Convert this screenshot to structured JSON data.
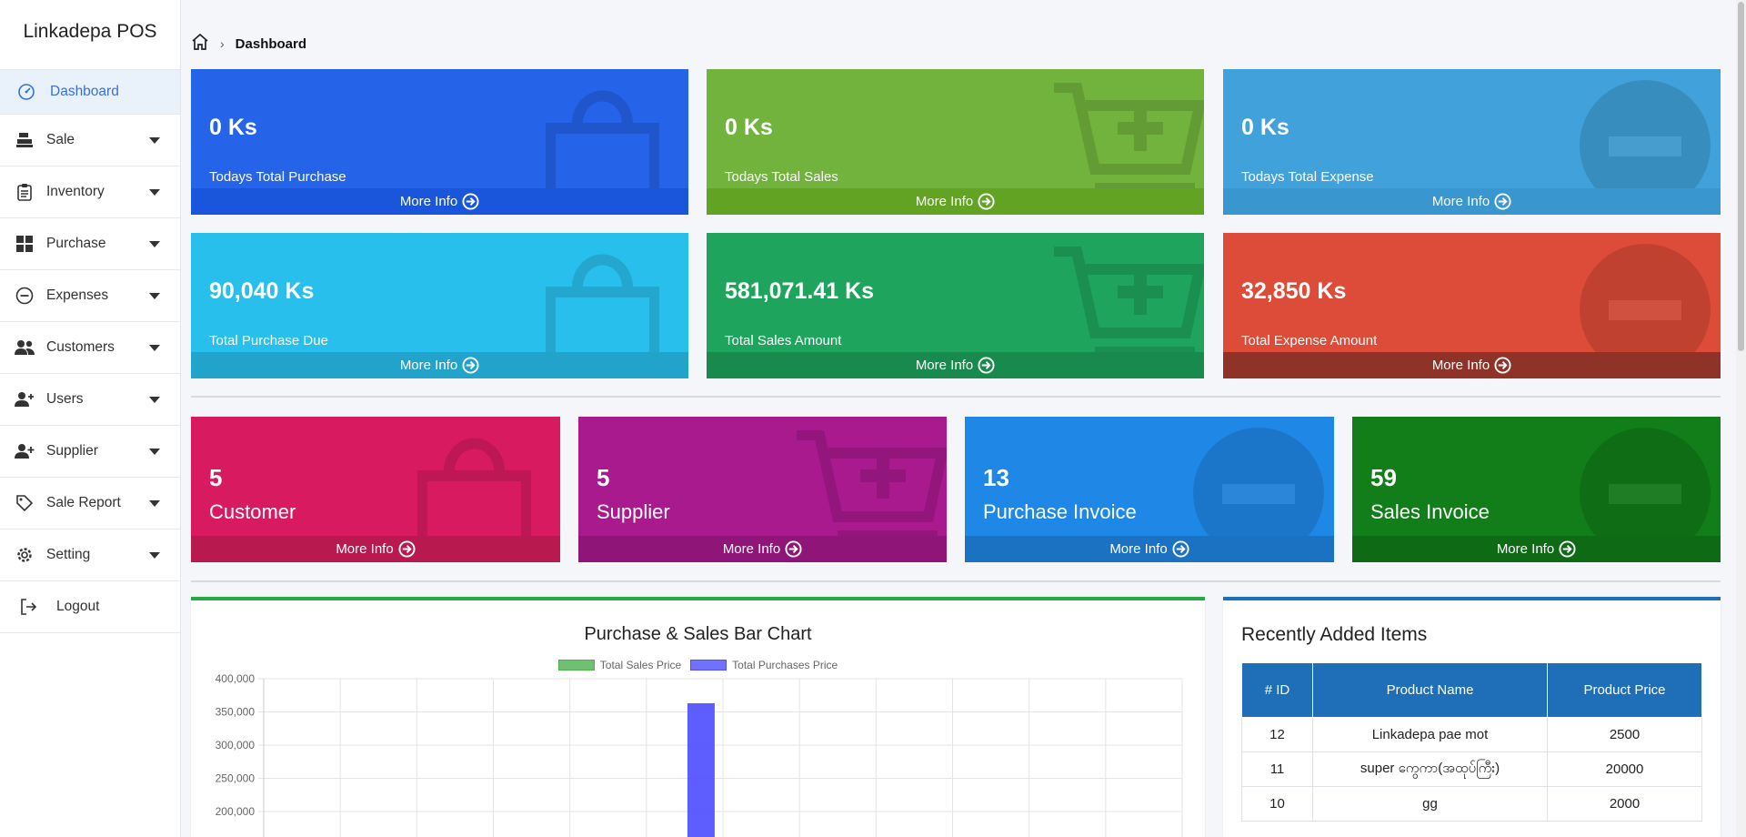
{
  "app": {
    "title": "Linkadepa POS"
  },
  "sidebar": {
    "items": [
      {
        "label": "Dashboard",
        "icon": "gauge-icon",
        "active": true
      },
      {
        "label": "Sale",
        "icon": "cash-register-icon"
      },
      {
        "label": "Inventory",
        "icon": "clipboard-icon"
      },
      {
        "label": "Purchase",
        "icon": "grid-icon"
      },
      {
        "label": "Expenses",
        "icon": "minus-circle-icon"
      },
      {
        "label": "Customers",
        "icon": "users-icon"
      },
      {
        "label": "Users",
        "icon": "user-gear-icon"
      },
      {
        "label": "Supplier",
        "icon": "user-plus-icon"
      },
      {
        "label": "Sale Report",
        "icon": "tag-icon"
      },
      {
        "label": "Setting",
        "icon": "gear-icon"
      },
      {
        "label": "Logout",
        "icon": "logout-icon"
      }
    ]
  },
  "breadcrumb": {
    "current": "Dashboard"
  },
  "more_info": "More Info",
  "stats_top": [
    {
      "value": "0 Ks",
      "label": "Todays Total Purchase",
      "color": "#2563e8",
      "foot": "#1a56dc"
    },
    {
      "value": "0 Ks",
      "label": "Todays Total Sales",
      "color": "#72b33d",
      "foot": "#62a323"
    },
    {
      "value": "0 Ks",
      "label": "Todays Total Expense",
      "color": "#41a2db",
      "foot": "#3996ce"
    },
    {
      "value": "90,040 Ks",
      "label": "Total Purchase Due",
      "color": "#28bfec",
      "foot": "#22a3cb"
    },
    {
      "value": "581,071.41 Ks",
      "label": "Total Sales Amount",
      "color": "#1ea45c",
      "foot": "#198a4d"
    },
    {
      "value": "32,850 Ks",
      "label": "Total Expense Amount",
      "color": "#dd4b39",
      "foot": "#8f3227"
    }
  ],
  "stats_count": [
    {
      "value": "5",
      "label": "Customer",
      "color": "#d81b60",
      "foot": "#b81a50"
    },
    {
      "value": "5",
      "label": "Supplier",
      "color": "#a91a8f",
      "foot": "#8f1579"
    },
    {
      "value": "13",
      "label": "Purchase Invoice",
      "color": "#1f87e6",
      "foot": "#1b72c3"
    },
    {
      "value": "59",
      "label": "Sales Invoice",
      "color": "#127e19",
      "foot": "#0e6a14"
    }
  ],
  "chart_data": {
    "type": "bar",
    "title": "Purchase & Sales Bar Chart",
    "series": [
      {
        "name": "Total Sales Price",
        "color": "#4caf50"
      },
      {
        "name": "Total Purchases Price",
        "color": "#4d4dff",
        "values": [
          363000
        ]
      }
    ],
    "y_ticks": [
      "400,000",
      "350,000",
      "300,000",
      "250,000",
      "200,000"
    ],
    "ylim": [
      0,
      400000
    ],
    "grid": true
  },
  "recent": {
    "title": "Recently Added Items",
    "headers": [
      "# ID",
      "Product Name",
      "Product Price"
    ],
    "rows": [
      [
        "12",
        "Linkadepa pae mot",
        "2500"
      ],
      [
        "11",
        "super ကွေကာ(အထုပ်ကြီး)",
        "20000"
      ],
      [
        "10",
        "gg",
        "2000"
      ]
    ]
  }
}
